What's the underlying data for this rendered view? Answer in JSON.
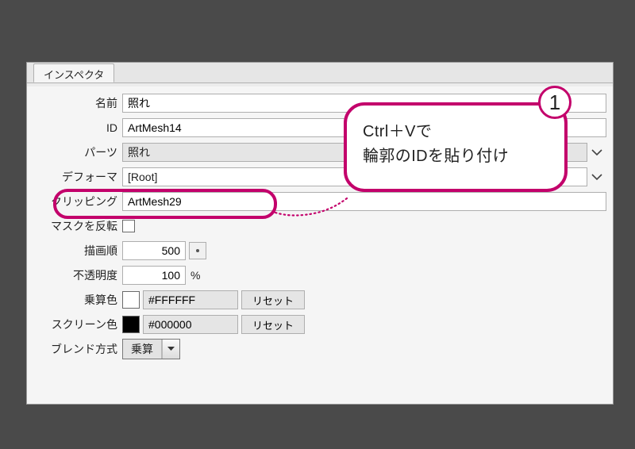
{
  "tab": {
    "title": "インスペクタ"
  },
  "fields": {
    "name": {
      "label": "名前",
      "value": "照れ"
    },
    "id": {
      "label": "ID",
      "value": "ArtMesh14"
    },
    "parts": {
      "label": "パーツ",
      "value": "照れ"
    },
    "deform": {
      "label": "デフォーマ",
      "value": "[Root]"
    },
    "clip": {
      "label": "クリッピング",
      "value": "ArtMesh29"
    },
    "mask": {
      "label": "マスクを反転"
    },
    "order": {
      "label": "描画順",
      "value": "500"
    },
    "opacity": {
      "label": "不透明度",
      "value": "100",
      "unit": "%"
    },
    "mul": {
      "label": "乗算色",
      "hex": "#FFFFFF",
      "swatch": "#FFFFFF",
      "reset": "リセット"
    },
    "scr": {
      "label": "スクリーン色",
      "hex": "#000000",
      "swatch": "#000000",
      "reset": "リセット"
    },
    "blend": {
      "label": "ブレンド方式",
      "value": "乗算"
    }
  },
  "annotation": {
    "badge": "1",
    "line1": "Ctrl＋Vで",
    "line2": "輪郭のIDを貼り付け"
  },
  "colors": {
    "accent": "#c3006b"
  }
}
